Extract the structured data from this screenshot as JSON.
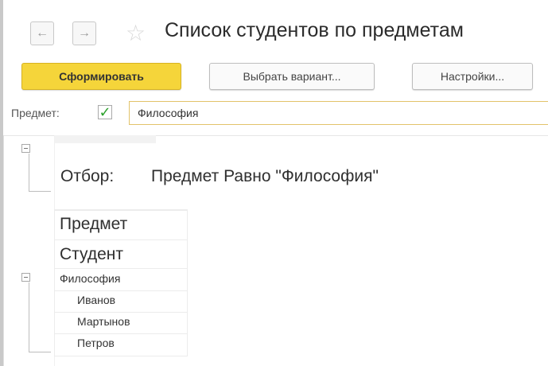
{
  "window": {
    "title": "Список студентов по предметам",
    "back_icon": "arrow-left-icon",
    "forward_icon": "arrow-right-icon",
    "favorite_icon": "star-icon"
  },
  "toolbar": {
    "generate_label": "Сформировать",
    "choose_variant_label": "Выбрать вариант...",
    "settings_label": "Настройки..."
  },
  "filter": {
    "label": "Предмет:",
    "checked": true,
    "value": "Философия"
  },
  "report": {
    "selection_label": "Отбор:",
    "selection_value": "Предмет Равно \"Философия\"",
    "header_subject": "Предмет",
    "header_student": "Студент",
    "groups": [
      {
        "subject": "Философия",
        "students": [
          "Иванов",
          "Мартынов",
          "Петров"
        ]
      }
    ]
  },
  "colors": {
    "primary_button": "#f5d53a",
    "checkbox_mark": "#2ca02c",
    "field_border": "#e2c36a"
  }
}
